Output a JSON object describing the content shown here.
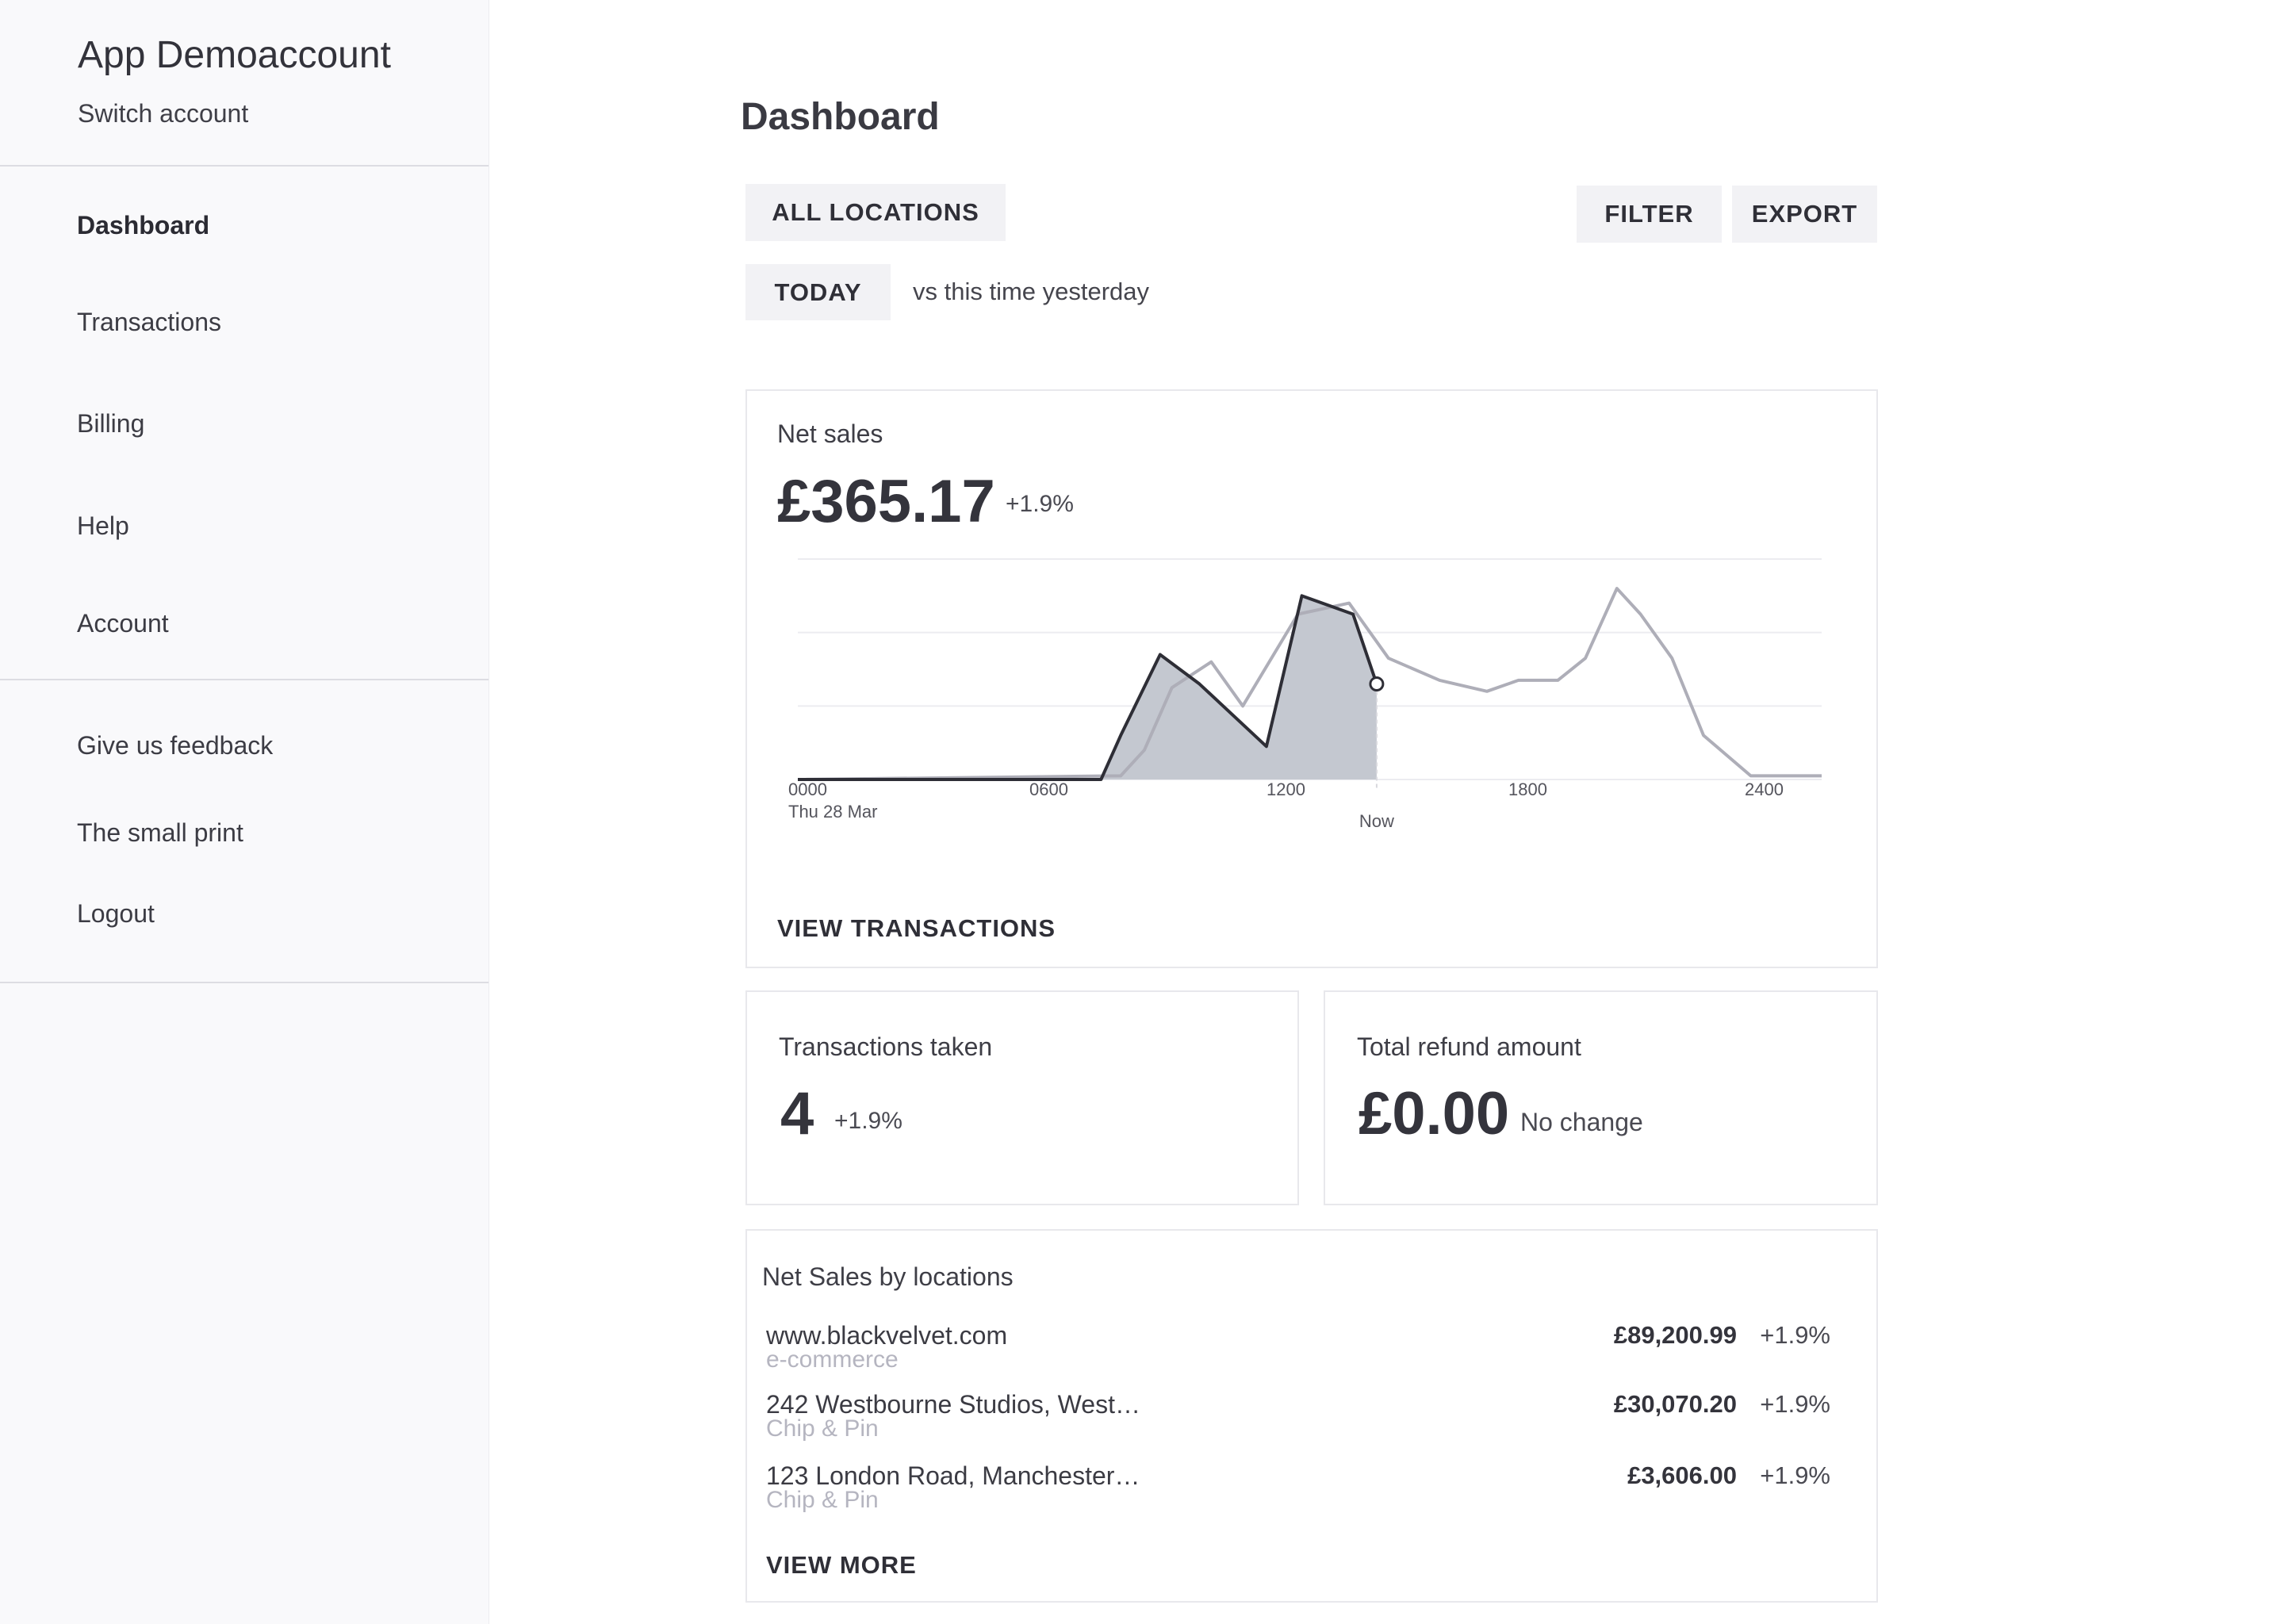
{
  "sidebar": {
    "account_name": "App Demoaccount",
    "switch_account": "Switch account",
    "nav": [
      {
        "label": "Dashboard",
        "active": true
      },
      {
        "label": "Transactions",
        "active": false
      },
      {
        "label": "Billing",
        "active": false
      },
      {
        "label": "Help",
        "active": false
      },
      {
        "label": "Account",
        "active": false
      }
    ],
    "secondary": [
      {
        "label": "Give us feedback"
      },
      {
        "label": "The small print"
      },
      {
        "label": "Logout"
      }
    ]
  },
  "main": {
    "title": "Dashboard",
    "locations_button": "ALL LOCATIONS",
    "filter_button": "FILTER",
    "export_button": "EXPORT",
    "period_button": "TODAY",
    "compare_text": "vs this time yesterday"
  },
  "net_sales": {
    "label": "Net sales",
    "value": "£365.17",
    "delta": "+1.9%",
    "view_link": "VIEW TRANSACTIONS"
  },
  "chart_data": {
    "type": "line",
    "x_ticks": [
      "0000",
      "0600",
      "1200",
      "1800",
      "2400"
    ],
    "x_date_label": "Thu 28 Mar",
    "now_label": "Now",
    "now_x": 14.7,
    "xlim": [
      0,
      26
    ],
    "ylim": [
      0,
      3
    ],
    "grid": true,
    "series": [
      {
        "role": "today",
        "color": "#2e2e36",
        "filled": true,
        "x": [
          0,
          7.7,
          8.2,
          9.2,
          10.2,
          11.9,
          12.8,
          14.1,
          14.7
        ],
        "y": [
          0,
          0,
          0.6,
          1.7,
          1.3,
          0.45,
          2.5,
          2.25,
          1.3
        ]
      },
      {
        "role": "yesterday",
        "color": "#aeaeb8",
        "filled": false,
        "x": [
          0,
          8.2,
          8.8,
          9.5,
          10.5,
          11.3,
          12.7,
          14.0,
          15.0,
          16.3,
          17.5,
          18.3,
          19.3,
          20.0,
          20.8,
          21.4,
          22.2,
          23.0,
          24.2,
          26.0
        ],
        "y": [
          0,
          0.05,
          0.4,
          1.25,
          1.6,
          1.0,
          2.25,
          2.4,
          1.65,
          1.35,
          1.2,
          1.35,
          1.35,
          1.65,
          2.6,
          2.25,
          1.65,
          0.6,
          0.05,
          0.05
        ]
      }
    ]
  },
  "transactions": {
    "label": "Transactions taken",
    "value": "4",
    "delta": "+1.9%"
  },
  "refunds": {
    "label": "Total refund amount",
    "value": "£0.00",
    "delta": "No change"
  },
  "locations": {
    "title": "Net Sales by locations",
    "rows": [
      {
        "name": "www.blackvelvet.com",
        "type": "e-commerce",
        "amount": "£89,200.99",
        "delta": "+1.9%"
      },
      {
        "name": "242 Westbourne Studios, West…",
        "type": "Chip & Pin",
        "amount": "£30,070.20",
        "delta": "+1.9%"
      },
      {
        "name": "123 London Road, Manchester…",
        "type": "Chip & Pin",
        "amount": "£3,606.00",
        "delta": "+1.9%"
      }
    ],
    "view_more": "VIEW MORE"
  }
}
